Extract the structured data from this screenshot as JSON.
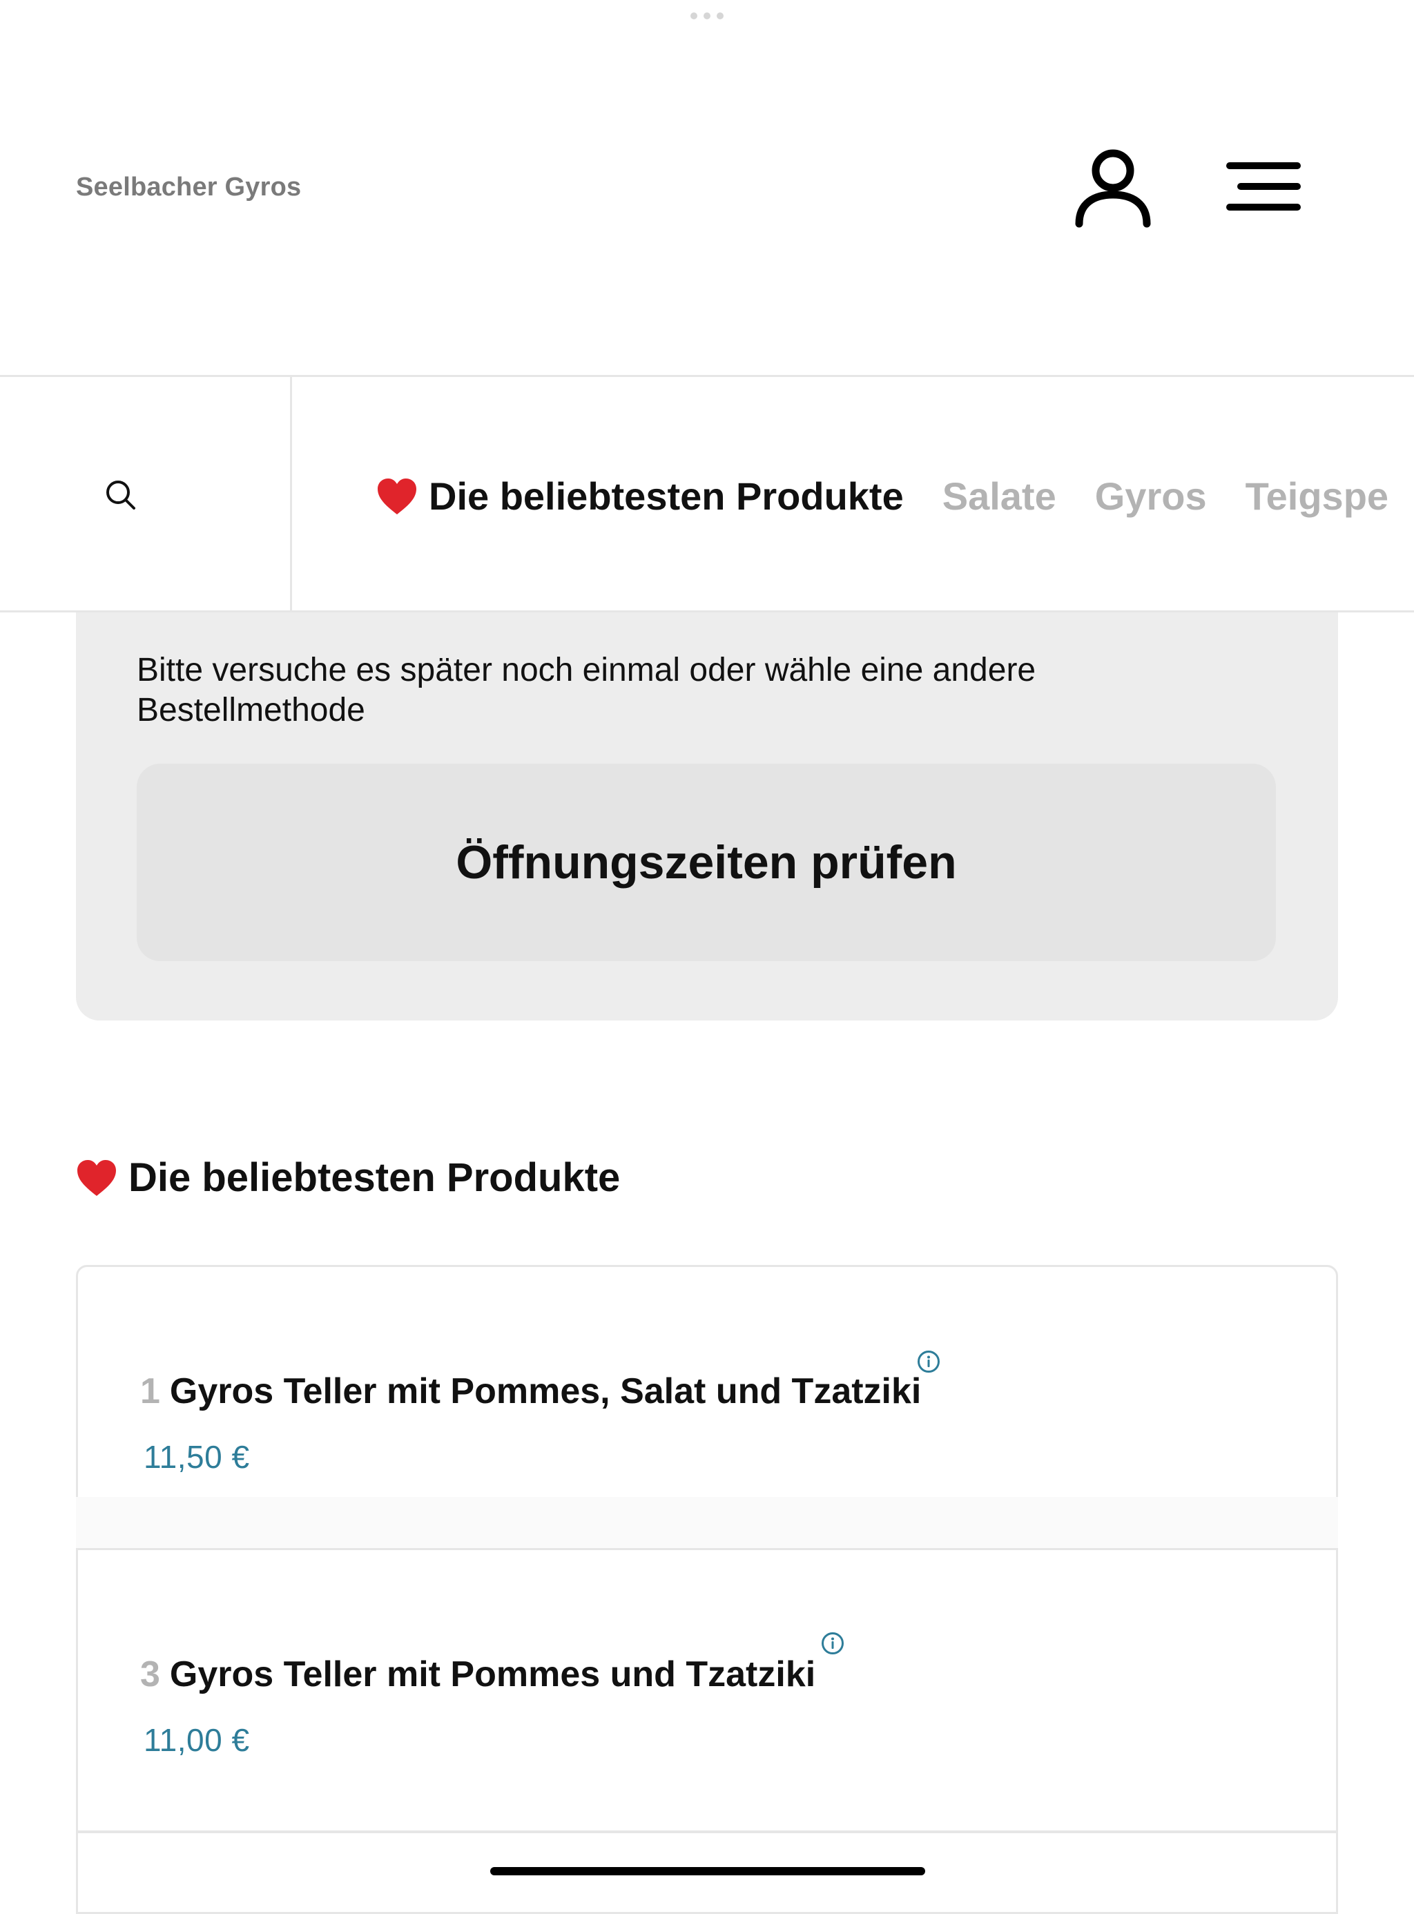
{
  "header": {
    "brand": "Seelbacher Gyros"
  },
  "categories": {
    "tabs": [
      {
        "label": "Die beliebtesten Produkte",
        "active": true
      },
      {
        "label": "Salate",
        "active": false
      },
      {
        "label": "Gyros",
        "active": false
      },
      {
        "label": "Teigspe",
        "active": false
      }
    ]
  },
  "notice": {
    "text": "Bitte versuche es später noch einmal oder wähle eine andere Bestellmethode",
    "button_label": "Öffnungszeiten prüfen"
  },
  "section": {
    "title": "Die beliebtesten Produkte"
  },
  "products": [
    {
      "number": "1",
      "name": "Gyros Teller mit Pommes, Salat und Tzatziki",
      "price": "11,50 €"
    },
    {
      "number": "3",
      "name": "Gyros Teller mit Pommes und Tzatziki",
      "price": "11,00 €"
    }
  ],
  "colors": {
    "accent": "#2e7d99",
    "heart": "#e0242b",
    "muted_text": "#b3b3b3",
    "card_bg": "#ededed"
  },
  "icons": {
    "account": "user-icon",
    "menu": "hamburger-menu-icon",
    "search": "search-icon",
    "favorite": "heart-icon",
    "info": "info-icon"
  }
}
